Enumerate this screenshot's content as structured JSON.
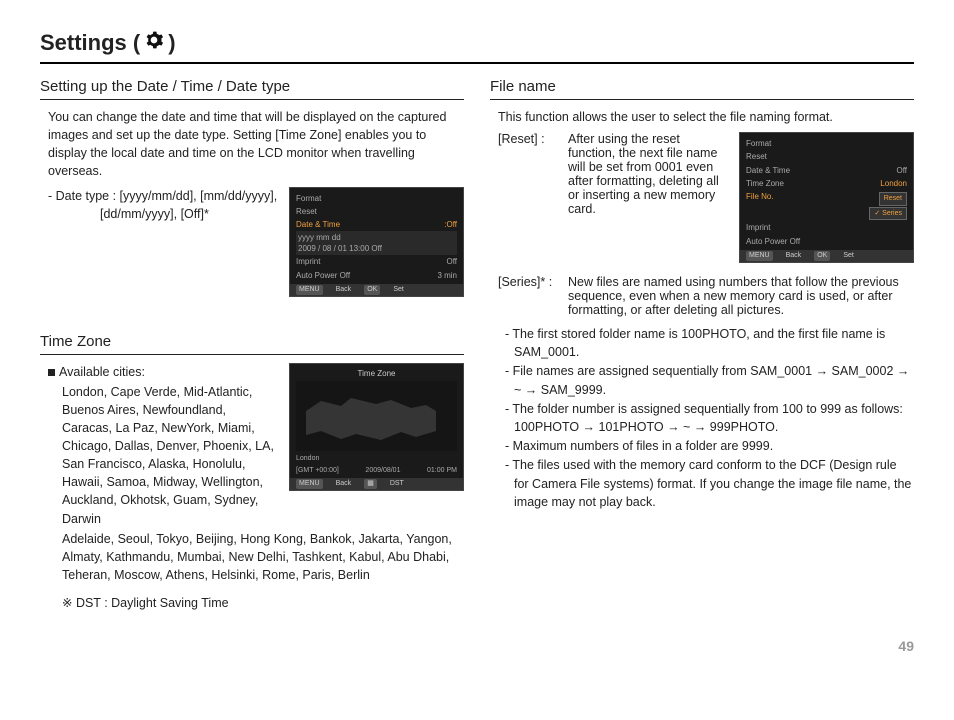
{
  "page": {
    "title_prefix": "Settings (",
    "title_suffix": ")",
    "number": "49"
  },
  "left": {
    "sec1": {
      "heading": "Setting up the Date / Time / Date type",
      "p1": "You can change the date and time that will be displayed on the captured images and set up the date type. Setting [Time Zone] enables you to display the local date and time on the LCD monitor when travelling overseas.",
      "p2a": "- Date type : [yyyy/mm/dd], [mm/dd/yyyy],",
      "p2b": "[dd/mm/yyyy], [Off]*"
    },
    "screen1": {
      "i1": "Format",
      "i2": "Reset",
      "i3a": "Date & Time",
      "i3b": ":Off",
      "i4a": "yyyy mm dd",
      "i4b": "2009 / 08 / 01    13:00    Off",
      "i5a": "Imprint",
      "i5b": "Off",
      "i6a": "Auto Power Off",
      "i6b": "3 min",
      "back": "Back",
      "set": "Set"
    },
    "sec2": {
      "heading": "Time Zone",
      "lead": "Available cities:",
      "cities1": "London, Cape Verde, Mid-Atlantic, Buenos Aires, Newfoundland, Caracas, La Paz, NewYork, Miami, Chicago, Dallas, Denver, Phoenix, LA, San Francisco, Alaska, Honolulu, Hawaii, Samoa, Midway, Wellington, Auckland, Okhotsk, Guam, Sydney, Darwin",
      "cities2": "Adelaide, Seoul, Tokyo, Beijing, Hong Kong, Bankok, Jakarta, Yangon, Almaty, Kathmandu, Mumbai, New Delhi, Tashkent, Kabul, Abu Dhabi, Teheran, Moscow, Athens, Helsinki, Rome, Paris, Berlin",
      "dst_note": "※ DST : Daylight Saving Time"
    },
    "screen2": {
      "title": "Time Zone",
      "city": "London",
      "gmt": "[GMT +00:00]",
      "date": "2009/08/01",
      "time": "01:00 PM",
      "back": "Back",
      "dst": "DST"
    }
  },
  "right": {
    "sec1": {
      "heading": "File name",
      "p1": "This function allows the user to select the file naming format.",
      "reset_term": "[Reset]  :",
      "reset_desc": "After using the reset function, the next file name will be set from 0001 even after formatting, deleting all or inserting a new memory card.",
      "series_term": "[Series]* :",
      "series_desc": "New files are named using numbers that follow the previous sequence, even when a new memory card is used, or after formatting, or after deleting all pictures.",
      "b1": "- The first stored folder name is 100PHOTO, and the first file name is SAM_0001.",
      "b2": "- File names are assigned sequentially from SAM_0001 → SAM_0002 → ~ → SAM_9999.",
      "b3": "- The folder number is assigned sequentially from 100 to 999 as follows: 100PHOTO → 101PHOTO → ~ → 999PHOTO.",
      "b4": "- Maximum numbers of files in a folder are 9999.",
      "b5": "- The files used with the memory card conform to the DCF (Design rule for Camera File systems) format. If you change the image file name, the image may not play back."
    },
    "screen3": {
      "i1": "Format",
      "i2": "Reset",
      "i3a": "Date & Time",
      "i3b": "Off",
      "i4a": "Time Zone",
      "i4b": "London",
      "i5": "File No.",
      "i6": "Imprint",
      "i7": "Auto Power Off",
      "pop1": "Reset",
      "pop2": "Series",
      "back": "Back",
      "set": "Set"
    }
  }
}
